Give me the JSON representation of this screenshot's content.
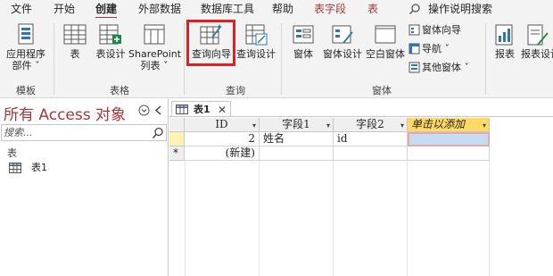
{
  "menu": {
    "items": [
      "文件",
      "开始",
      "创建",
      "外部数据",
      "数据库工具",
      "帮助",
      "表字段",
      "表"
    ],
    "active": "创建",
    "search_label": "操作说明搜索"
  },
  "ribbon": {
    "app_parts": "应用程序\n部件 ˇ",
    "app_parts_l1": "应用程序",
    "app_parts_l2": "部件 ˇ",
    "table": "表",
    "table_design": "表设计",
    "sharepoint_l1": "SharePoint",
    "sharepoint_l2": "列表 ˇ",
    "query_wizard": "查询向导",
    "query_design": "查询设计",
    "form": "窗体",
    "form_design": "窗体设计",
    "blank_form": "空白窗体",
    "form_wizard": "窗体向导",
    "navigation": "导航 ˇ",
    "more_forms": "其他窗体 ˇ",
    "report": "报表",
    "report_design": "报表设计",
    "groups": {
      "templates": "模板",
      "tables": "表格",
      "queries": "查询",
      "forms": "窗体"
    }
  },
  "nav_pane": {
    "title": "所有 Access 对象",
    "search_placeholder": "搜索...",
    "section": "表",
    "items": [
      "表1"
    ]
  },
  "document": {
    "tab_label": "表1",
    "columns": [
      "ID",
      "字段1",
      "字段2",
      "单击以添加"
    ],
    "rows": [
      {
        "id": "2",
        "field1": "姓名",
        "field2": "id",
        "add": ""
      }
    ],
    "new_row_label": "(新建)",
    "new_row_marker": "*"
  },
  "colors": {
    "accent": "#a4373a",
    "highlight_box": "#e02020",
    "add_column": "#ffd966"
  }
}
